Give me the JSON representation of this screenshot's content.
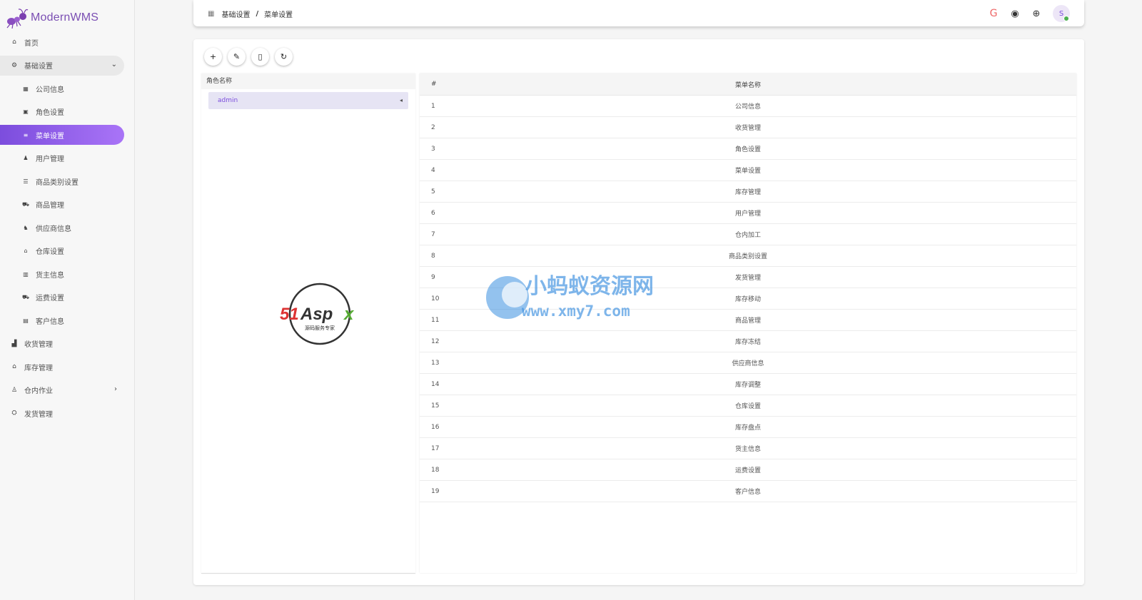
{
  "app": {
    "name": "ModernWMS"
  },
  "sidebar": {
    "items": [
      {
        "label": "首页",
        "icon": "home-icon",
        "glyph": "⌂",
        "level": 0
      },
      {
        "label": "基础设置",
        "icon": "gear-icon",
        "glyph": "⚙",
        "level": 0,
        "expanded": true,
        "chevron": "⌄"
      },
      {
        "label": "公司信息",
        "icon": "company-icon",
        "glyph": "▦",
        "level": 1
      },
      {
        "label": "角色设置",
        "icon": "role-icon",
        "glyph": "▣",
        "level": 1
      },
      {
        "label": "菜单设置",
        "icon": "menu-icon",
        "glyph": "≡",
        "level": 1,
        "active": true
      },
      {
        "label": "用户管理",
        "icon": "user-icon",
        "glyph": "♟",
        "level": 1
      },
      {
        "label": "商品类别设置",
        "icon": "category-icon",
        "glyph": "☰",
        "level": 1
      },
      {
        "label": "商品管理",
        "icon": "cart-icon",
        "glyph": "⛟",
        "level": 1
      },
      {
        "label": "供应商信息",
        "icon": "supplier-icon",
        "glyph": "♞",
        "level": 1
      },
      {
        "label": "仓库设置",
        "icon": "warehouse-icon",
        "glyph": "⌂",
        "level": 1
      },
      {
        "label": "货主信息",
        "icon": "owner-icon",
        "glyph": "▥",
        "level": 1
      },
      {
        "label": "运费设置",
        "icon": "freight-icon",
        "glyph": "⛟",
        "level": 1
      },
      {
        "label": "客户信息",
        "icon": "customer-icon",
        "glyph": "▤",
        "level": 1
      },
      {
        "label": "收货管理",
        "icon": "receive-icon",
        "glyph": "▟",
        "level": 0
      },
      {
        "label": "库存管理",
        "icon": "stock-icon",
        "glyph": "⌂",
        "level": 0
      },
      {
        "label": "仓内作业",
        "icon": "operation-icon",
        "glyph": "♙",
        "level": 0,
        "chevron": "›"
      },
      {
        "label": "发货管理",
        "icon": "ship-icon",
        "glyph": "⛭",
        "level": 0
      }
    ]
  },
  "header": {
    "breadcrumb": [
      "基础设置",
      "菜单设置"
    ],
    "separator": "/",
    "icons": [
      {
        "name": "gitee-icon",
        "glyph": "G"
      },
      {
        "name": "github-icon",
        "glyph": "◉"
      },
      {
        "name": "language-icon",
        "glyph": "⊕"
      }
    ],
    "avatar": "S"
  },
  "toolbar": [
    {
      "name": "add-button",
      "glyph": "+"
    },
    {
      "name": "edit-button",
      "glyph": "✎"
    },
    {
      "name": "delete-button",
      "glyph": "▯"
    },
    {
      "name": "refresh-button",
      "glyph": "↻"
    }
  ],
  "role_panel": {
    "header": "角色名称",
    "roles": [
      {
        "label": "admin",
        "selected": true,
        "arrow": "◂"
      }
    ]
  },
  "menu_table": {
    "columns": [
      "#",
      "菜单名称"
    ],
    "rows": [
      [
        "1",
        "公司信息"
      ],
      [
        "2",
        "收货管理"
      ],
      [
        "3",
        "角色设置"
      ],
      [
        "4",
        "菜单设置"
      ],
      [
        "5",
        "库存管理"
      ],
      [
        "6",
        "用户管理"
      ],
      [
        "7",
        "仓内加工"
      ],
      [
        "8",
        "商品类别设置"
      ],
      [
        "9",
        "发货管理"
      ],
      [
        "10",
        "库存移动"
      ],
      [
        "11",
        "商品管理"
      ],
      [
        "12",
        "库存冻结"
      ],
      [
        "13",
        "供应商信息"
      ],
      [
        "14",
        "库存调整"
      ],
      [
        "15",
        "仓库设置"
      ],
      [
        "16",
        "库存盘点"
      ],
      [
        "17",
        "货主信息"
      ],
      [
        "18",
        "运费设置"
      ],
      [
        "19",
        "客户信息"
      ]
    ]
  },
  "watermarks": {
    "logo": {
      "brand": "51Aspx",
      "tagline": "源码服务专家"
    },
    "site": {
      "name": "小蚂蚁资源网",
      "url": "www.xmy7.com"
    }
  },
  "colors": {
    "accent": "#7c4ddd",
    "accent_light": "#a974f7",
    "success": "#4caf50"
  }
}
